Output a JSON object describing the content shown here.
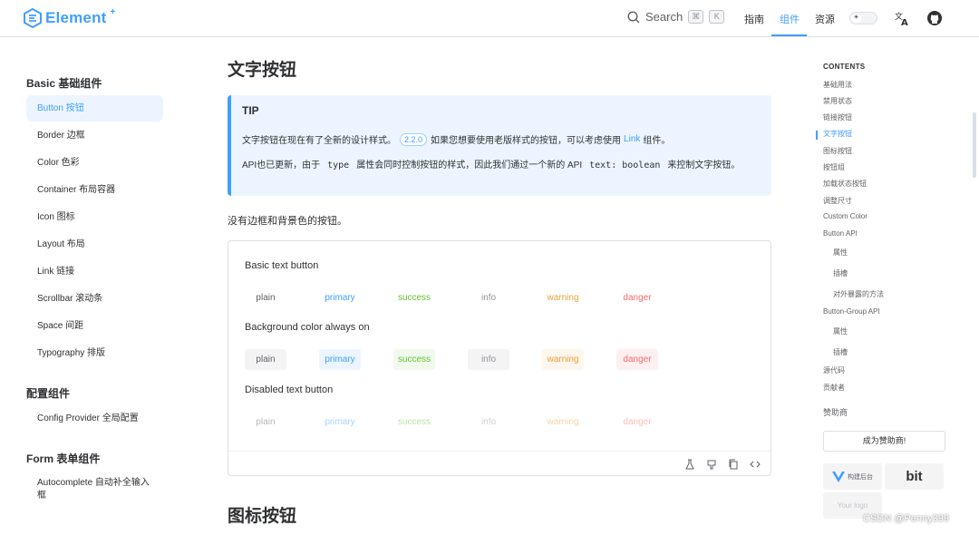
{
  "header": {
    "logo_text": "Element",
    "logo_sup": "+",
    "search_label": "Search",
    "kbd_cmd": "⌘",
    "kbd_k": "K",
    "nav": [
      "指南",
      "组件",
      "资源"
    ],
    "active_nav": "组件",
    "theme_icon": "sun-icon",
    "lang_icon": "translate-icon",
    "github_icon": "github-icon",
    "accent_color": "#409eff"
  },
  "sidebar": {
    "groups": [
      {
        "title": "Basic 基础组件",
        "items": [
          "Button 按钮",
          "Border 边框",
          "Color 色彩",
          "Container 布局容器",
          "Icon 图标",
          "Layout 布局",
          "Link 链接",
          "Scrollbar 滚动条",
          "Space 间距",
          "Typography 排版"
        ]
      },
      {
        "title": "配置组件",
        "items": [
          "Config Provider 全局配置"
        ]
      },
      {
        "title": "Form 表单组件",
        "items": [
          "Autocomplete 自动补全输入框"
        ]
      }
    ],
    "active_item": "Button 按钮"
  },
  "main": {
    "title": "文字按钮",
    "tip": {
      "title": "TIP",
      "line1_before": "文字按钮在现在有了全新的设计样式。",
      "version": "2.2.0",
      "line1_middle": "如果您想要使用老版样式的按钮，可以考虑使用",
      "link_text": "Link",
      "line1_after": "组件。",
      "line2_a": "API也已更新，由于",
      "line2_code1": "type",
      "line2_b": "属性会同时控制按钮的样式，因此我们通过一个新的 API",
      "line2_code2": "text: boolean",
      "line2_c": "来控制文字按钮。"
    },
    "description": "没有边框和背景色的按钮。",
    "demo": {
      "subtitles": [
        "Basic text button",
        "Background color always on",
        "Disabled text button"
      ],
      "buttons": [
        "plain",
        "primary",
        "success",
        "info",
        "warning",
        "danger"
      ],
      "toolbar_icons": [
        "playground-icon",
        "github-icon",
        "copy-icon",
        "code-icon"
      ]
    },
    "next_title": "图标按钮"
  },
  "toc": {
    "heading": "CONTENTS",
    "items": [
      "基础用法",
      "禁用状态",
      "链接按钮",
      "文字按钮",
      "图标按钮",
      "按钮组",
      "加载状态按钮",
      "调整尺寸",
      "Custom Color",
      "Button API",
      "属性",
      "插槽",
      "对外暴露的方法",
      "Button-Group API",
      "属性",
      "插槽",
      "源代码",
      "贡献者"
    ],
    "active": "文字按钮",
    "sponsor_label": "赞助商",
    "sponsor_button": "成为赞助商!",
    "sponsor_card1": "构建后台",
    "sponsor_card2": "bit",
    "sponsor_card3": "Your logo"
  },
  "watermark": "CSDN @Penny399"
}
